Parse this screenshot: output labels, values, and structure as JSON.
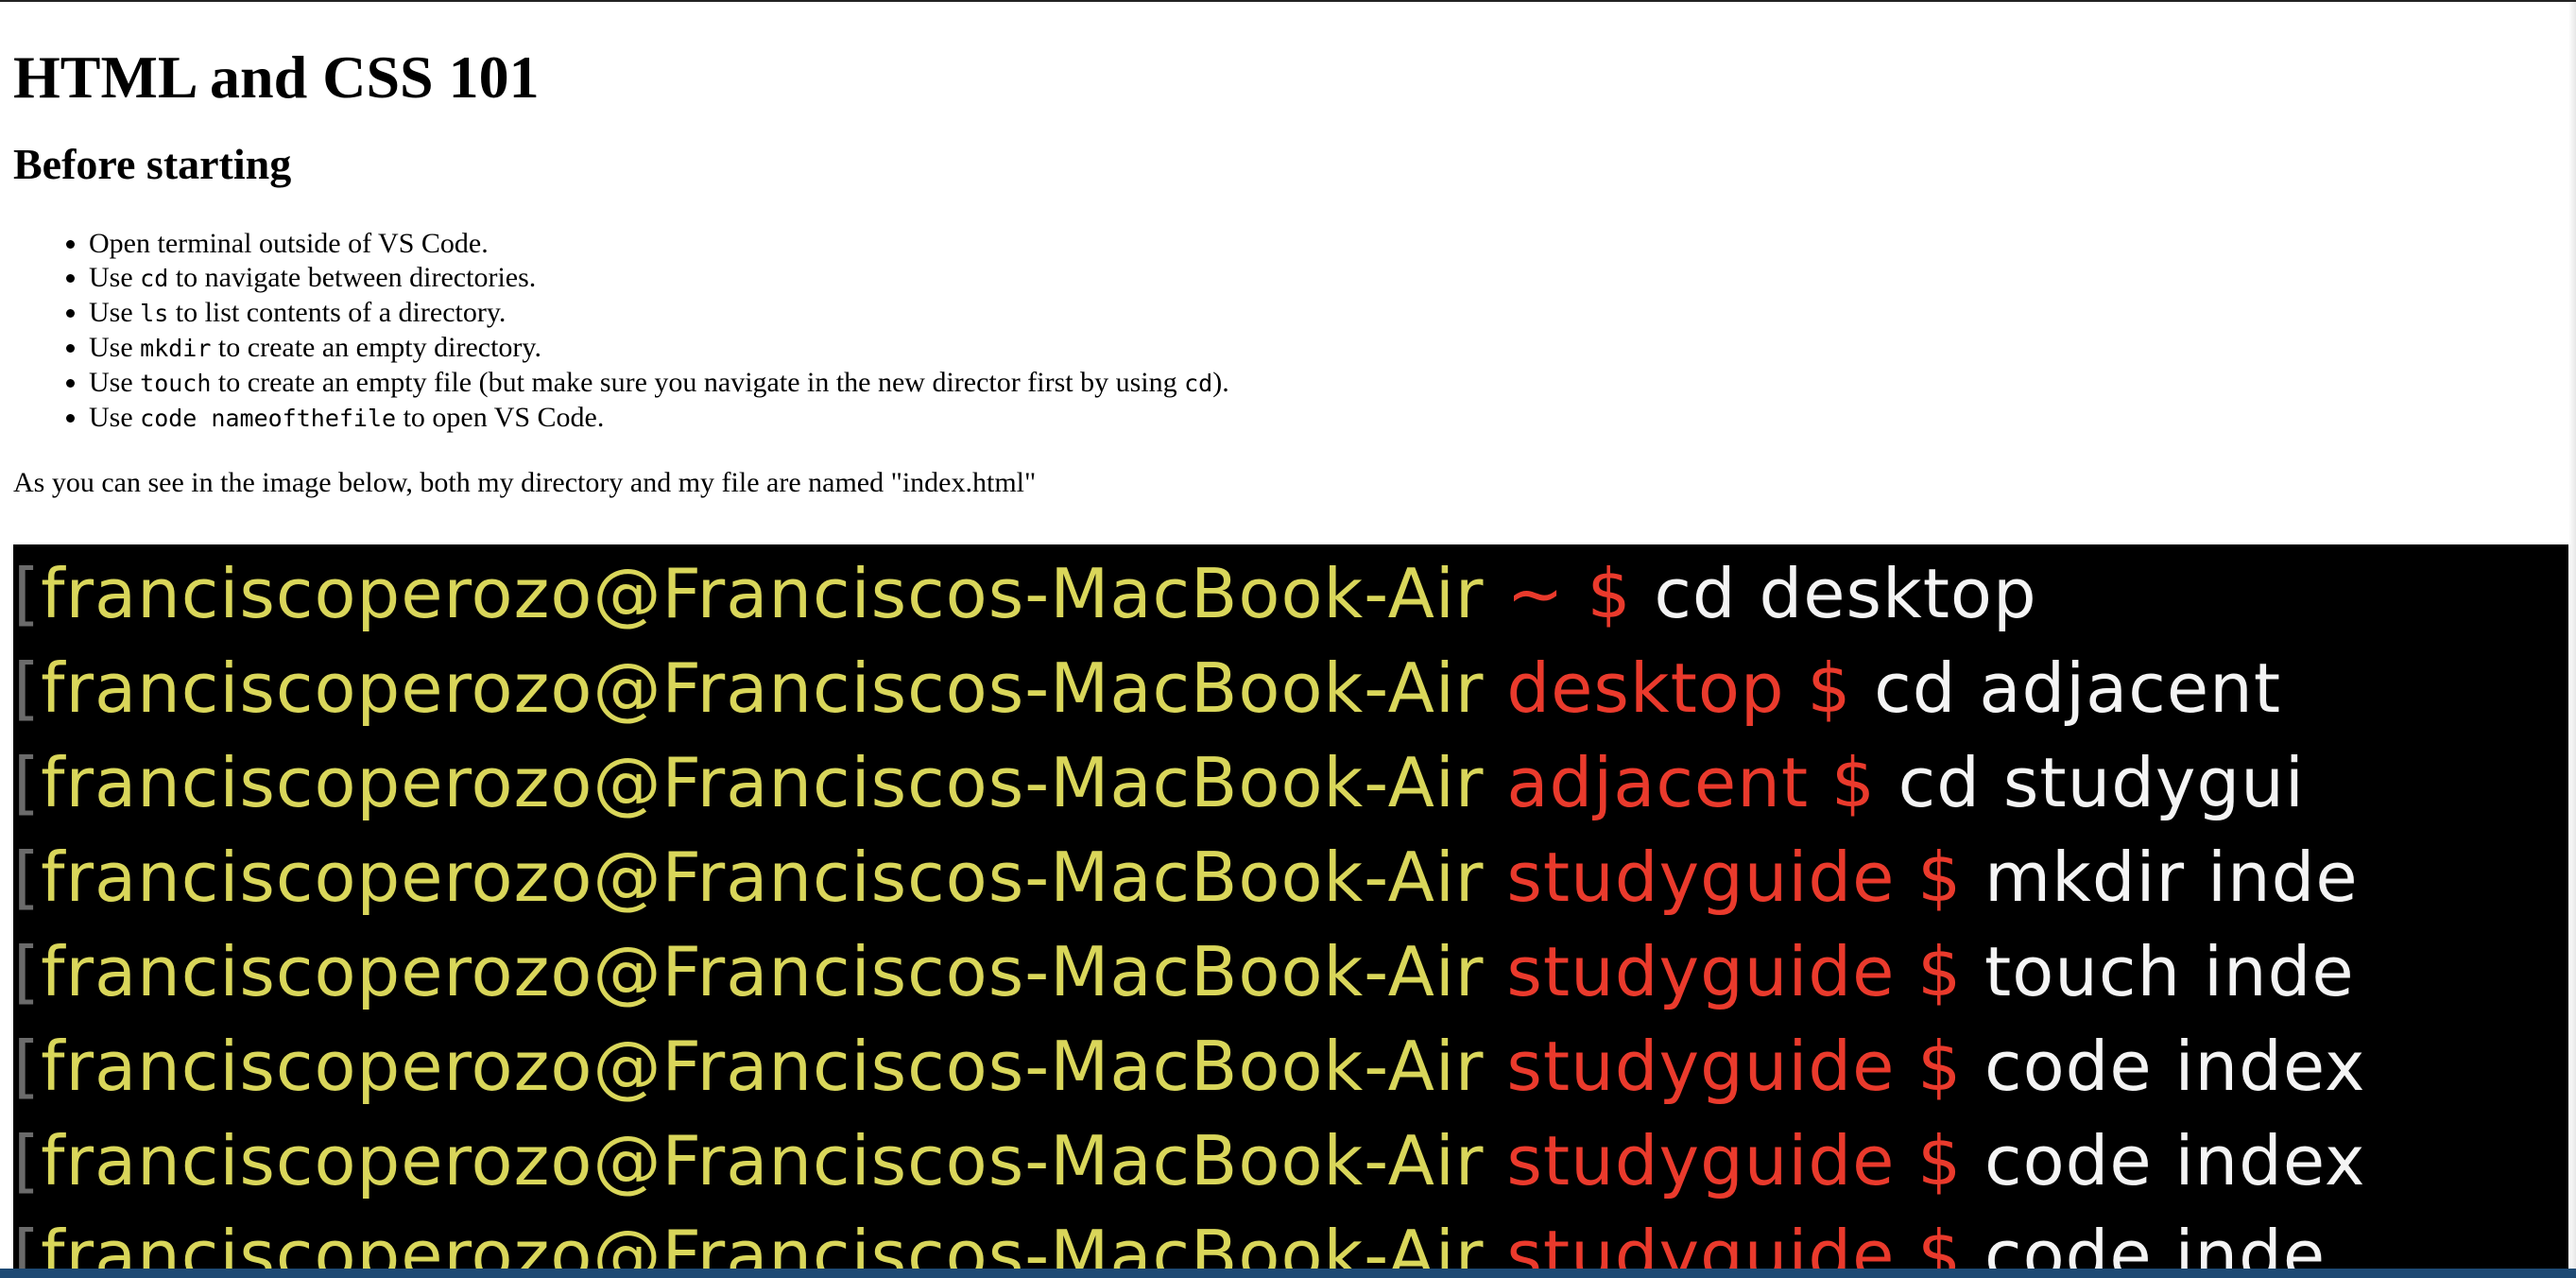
{
  "page": {
    "title": "HTML and CSS 101",
    "section_title": "Before starting",
    "steps": [
      {
        "pre": "Open terminal outside of VS Code.",
        "code": "",
        "post": ""
      },
      {
        "pre": "Use ",
        "code": "cd",
        "post": " to navigate between directories."
      },
      {
        "pre": "Use ",
        "code": "ls",
        "post": " to list contents of a directory."
      },
      {
        "pre": "Use ",
        "code": "mkdir",
        "post": " to create an empty directory."
      },
      {
        "pre": "Use ",
        "code": "touch",
        "post": " to create an empty file (but make sure you navigate in the new director first by using ",
        "code2": "cd",
        "post2": ")."
      },
      {
        "pre": "Use ",
        "code": "code nameofthefile",
        "post": " to open VS Code."
      }
    ],
    "note": "As you can see in the image below, both my directory and my file are named \"index.html\""
  },
  "terminal": {
    "bracket": "[",
    "lines": [
      {
        "host": "franciscoperozo@Franciscos-MacBook-Air",
        "dir": "~ $",
        "cmd": "cd desktop"
      },
      {
        "host": "franciscoperozo@Franciscos-MacBook-Air",
        "dir": "desktop $",
        "cmd": "cd adjacent"
      },
      {
        "host": "franciscoperozo@Franciscos-MacBook-Air",
        "dir": "adjacent $",
        "cmd": "cd studygui"
      },
      {
        "host": "franciscoperozo@Franciscos-MacBook-Air",
        "dir": "studyguide $",
        "cmd": "mkdir inde"
      },
      {
        "host": "franciscoperozo@Franciscos-MacBook-Air",
        "dir": "studyguide $",
        "cmd": "touch inde"
      },
      {
        "host": "franciscoperozo@Franciscos-MacBook-Air",
        "dir": "studyguide $",
        "cmd": "code index"
      },
      {
        "host": "franciscoperozo@Franciscos-MacBook-Air",
        "dir": "studyguide $",
        "cmd": "code index"
      },
      {
        "host": "franciscoperozo@Franciscos-MacBook-Air",
        "dir": "studyguide $",
        "cmd": "code inde"
      }
    ],
    "colors": {
      "background": "#000000",
      "host": "#d9d65a",
      "dir": "#ea3a2c",
      "cmd": "#f4f4f4"
    }
  }
}
